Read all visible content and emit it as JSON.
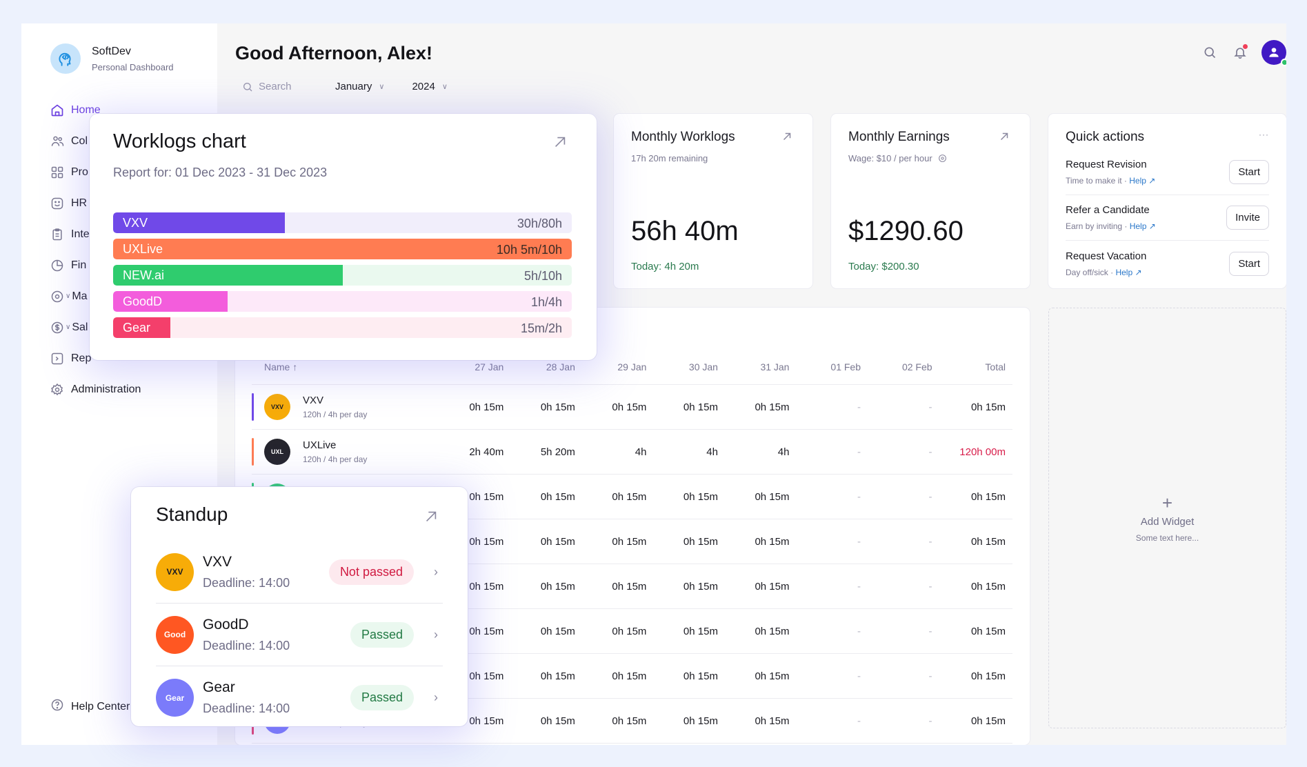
{
  "brand": {
    "name": "SoftDev",
    "subtitle": "Personal Dashboard",
    "icon": "head-code-icon"
  },
  "sidebar": {
    "items": [
      {
        "label": "Home",
        "icon": "home-icon",
        "active": true
      },
      {
        "label": "Col",
        "icon": "users-icon"
      },
      {
        "label": "Pro",
        "icon": "grid-icon"
      },
      {
        "label": "HR",
        "icon": "smile-icon"
      },
      {
        "label": "Inte",
        "icon": "clipboard-icon"
      },
      {
        "label": "Fin",
        "icon": "pie-icon"
      },
      {
        "label": "Ma",
        "icon": "eye-icon",
        "expandable": true
      },
      {
        "label": "Sal",
        "icon": "dollar-icon",
        "expandable": true
      },
      {
        "label": "Rep",
        "icon": "terminal-icon"
      },
      {
        "label": "Administration",
        "icon": "gear-icon"
      }
    ],
    "help": {
      "label": "Help Center",
      "icon": "question-icon"
    }
  },
  "header": {
    "greeting": "Good Afternoon, Alex!",
    "search_placeholder": "Search",
    "month": "January",
    "year": "2024",
    "icons": [
      "search-icon",
      "bell-icon",
      "avatar"
    ]
  },
  "monthly_worklogs": {
    "title": "Monthly Worklogs",
    "subtitle": "17h 20m remaining",
    "value": "56h 40m",
    "today": "Today: 4h 20m"
  },
  "monthly_earnings": {
    "title": "Monthly Earnings",
    "subtitle": "Wage: $10 / per hour",
    "value": "$1290.60",
    "today": "Today: $200.30"
  },
  "quick_actions": {
    "title": "Quick actions",
    "items": [
      {
        "name": "Request Revision",
        "desc": "Time to make it · ",
        "help": "Help ↗",
        "button": "Start"
      },
      {
        "name": "Refer a Candidate",
        "desc": "Earn by inviting · ",
        "help": "Help ↗",
        "button": "Invite"
      },
      {
        "name": "Request Vacation",
        "desc": "Day off/sick · ",
        "help": "Help ↗",
        "button": "Start"
      }
    ]
  },
  "worklog_table": {
    "columns": [
      "Name ↑",
      "27 Jan",
      "28 Jan",
      "29 Jan",
      "30 Jan",
      "31 Jan",
      "01 Feb",
      "02 Feb",
      "Total"
    ],
    "rows": [
      {
        "name": "VXV",
        "sub": "120h / 4h per day",
        "avatar": "VXV",
        "avatar_bg": "#f7ac08",
        "avatar_fg": "#1b1b22",
        "bar": "#7049e8",
        "cells": [
          "0h 15m",
          "0h 15m",
          "0h 15m",
          "0h 15m",
          "0h 15m",
          "-",
          "-"
        ],
        "total": "0h 15m",
        "total_alert": false
      },
      {
        "name": "UXLive",
        "sub": "120h / 4h per day",
        "avatar": "UXL",
        "avatar_bg": "#25252d",
        "avatar_fg": "#ffffff",
        "bar": "#ff7c52",
        "cells": [
          "2h 40m",
          "5h 20m",
          "4h",
          "4h",
          "4h",
          "-",
          "-"
        ],
        "total": "120h 00m",
        "total_alert": true
      },
      {
        "name": "",
        "sub": "",
        "avatar": "",
        "avatar_bg": "#2fcc6e",
        "avatar_fg": "#fff",
        "bar": "#2fcc6e",
        "cells": [
          "0h 15m",
          "0h 15m",
          "0h 15m",
          "0h 15m",
          "0h 15m",
          "-",
          "-"
        ],
        "total": "0h 15m",
        "total_alert": false
      },
      {
        "name": "",
        "sub": "",
        "avatar": "",
        "avatar_bg": "#f35ddc",
        "avatar_fg": "#fff",
        "bar": "#f35ddc",
        "cells": [
          "0h 15m",
          "0h 15m",
          "0h 15m",
          "0h 15m",
          "0h 15m",
          "-",
          "-"
        ],
        "total": "0h 15m",
        "total_alert": false
      },
      {
        "name": "",
        "sub": "",
        "avatar": "",
        "avatar_bg": "#ff5722",
        "avatar_fg": "#fff",
        "bar": "#ff5722",
        "cells": [
          "0h 15m",
          "0h 15m",
          "0h 15m",
          "0h 15m",
          "0h 15m",
          "-",
          "-"
        ],
        "total": "0h 15m",
        "total_alert": false
      },
      {
        "name": "",
        "sub": "",
        "avatar": "",
        "avatar_bg": "#7b7bfa",
        "avatar_fg": "#fff",
        "bar": "#7b7bfa",
        "cells": [
          "0h 15m",
          "0h 15m",
          "0h 15m",
          "0h 15m",
          "0h 15m",
          "-",
          "-"
        ],
        "total": "0h 15m",
        "total_alert": false
      },
      {
        "name": "",
        "sub": "",
        "avatar": "",
        "avatar_bg": "#f7ac08",
        "avatar_fg": "#fff",
        "bar": "#f7ac08",
        "cells": [
          "0h 15m",
          "0h 15m",
          "0h 15m",
          "0h 15m",
          "0h 15m",
          "-",
          "-"
        ],
        "total": "0h 15m",
        "total_alert": false
      },
      {
        "name": "",
        "sub": "120h / 4h per day",
        "avatar": "",
        "avatar_bg": "#7b7bfa",
        "avatar_fg": "#fff",
        "bar": "#e63f6a",
        "cells": [
          "0h 15m",
          "0h 15m",
          "0h 15m",
          "0h 15m",
          "0h 15m",
          "-",
          "-"
        ],
        "total": "0h 15m",
        "total_alert": false
      }
    ]
  },
  "add_widget": {
    "title": "Add Widget",
    "subtitle": "Some text here..."
  },
  "worklogs_chart": {
    "title": "Worklogs chart",
    "subtitle": "Report for: 01 Dec 2023 - 31 Dec 2023"
  },
  "chart_data": {
    "type": "bar",
    "orientation": "horizontal",
    "title": "Worklogs chart",
    "subtitle": "Report for: 01 Dec 2023 - 31 Dec 2023",
    "categories": [
      "VXV",
      "UXLive",
      "NEW.ai",
      "GoodD",
      "Gear"
    ],
    "series": [
      {
        "name": "logged_hours",
        "values": [
          30,
          10.083,
          5,
          1,
          0.25
        ]
      },
      {
        "name": "target_hours",
        "values": [
          80,
          10,
          10,
          4,
          2
        ]
      }
    ],
    "value_labels": [
      "30h/80h",
      "10h 5m/10h",
      "5h/10h",
      "1h/4h",
      "15m/2h"
    ],
    "colors": [
      "#7049e8",
      "#ff7c52",
      "#2fcc6e",
      "#f35ddc",
      "#f43f6b"
    ],
    "track_colors": [
      "#f1eefb",
      "#ffe7de",
      "#eaf9ef",
      "#fde9f9",
      "#feedf2"
    ],
    "label_colors": [
      "#5d5b70",
      "#3a2b25",
      "#5d5b70",
      "#5d5b70",
      "#5d5b70"
    ]
  },
  "standup": {
    "title": "Standup",
    "items": [
      {
        "name": "VXV",
        "deadline": "Deadline: 14:00",
        "status": "Not passed",
        "passed": false,
        "avatar": "VXV",
        "avatar_bg": "#f7ac08",
        "avatar_fg": "#1b1b22"
      },
      {
        "name": "GoodD",
        "deadline": "Deadline: 14:00",
        "status": "Passed",
        "passed": true,
        "avatar": "Good",
        "avatar_bg": "#ff5722",
        "avatar_fg": "#ffffff"
      },
      {
        "name": "Gear",
        "deadline": "Deadline: 14:00",
        "status": "Passed",
        "passed": true,
        "avatar": "Gear",
        "avatar_bg": "#7b7bfa",
        "avatar_fg": "#ffffff"
      }
    ]
  }
}
